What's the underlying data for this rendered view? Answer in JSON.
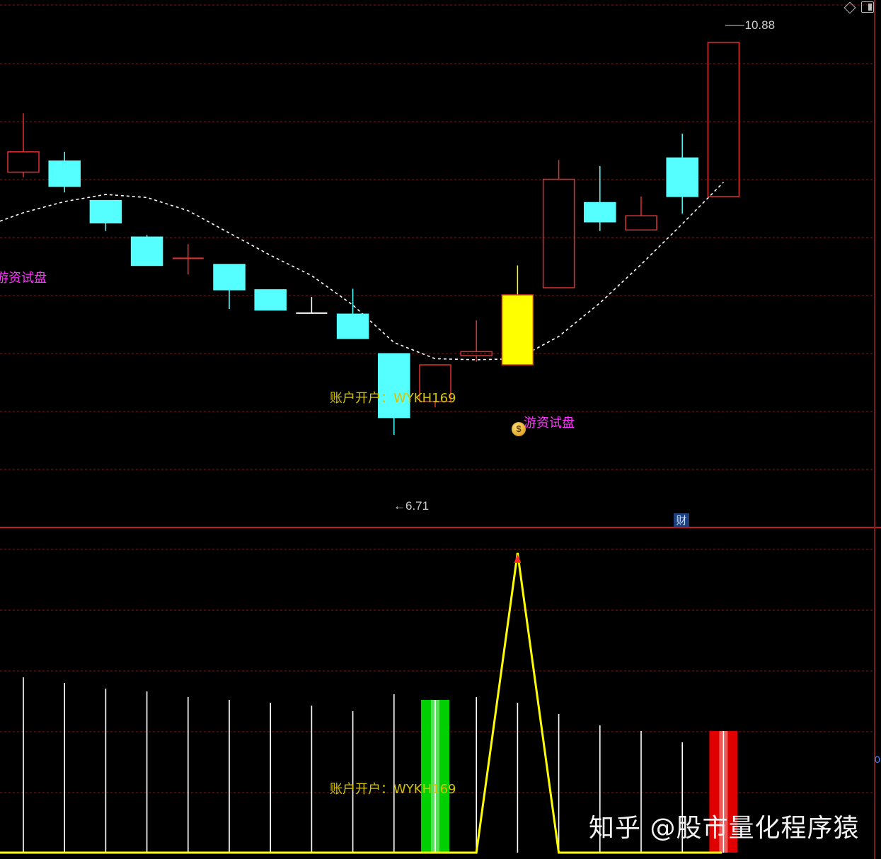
{
  "toolbar": {
    "icons": [
      "diamond-icon",
      "panel-toggle-icon"
    ]
  },
  "price_labels": {
    "high": "10.88",
    "low": "6.71"
  },
  "annotations": {
    "youzi_left": "游资试盘",
    "youzi_right": "游资试盘",
    "account_upper": "账户开户：WYKH169",
    "account_lower": "账户开户：WYKH169",
    "fin_badge": "财",
    "axis_edge": "0"
  },
  "watermark": "知乎 @股市量化程序猿",
  "colors": {
    "background": "#000000",
    "bear_body": "#55ffff",
    "bull_outline": "#e03030",
    "signal_candle": "#ffff00",
    "ma_line": "#ffffff",
    "grid": "#7a1a1a",
    "separator": "#c02020",
    "volume_line": "#ffffff",
    "signal_line": "#ffff00",
    "green_bar": "#00d000",
    "red_bar": "#e00000",
    "magenta_text": "#ff33ff"
  },
  "chart_data": [
    {
      "type": "candlestick",
      "price_range": [
        6.25,
        11.2
      ],
      "candles": [
        {
          "o": 9.6,
          "c": 9.8,
          "h": 10.18,
          "l": 9.55,
          "kind": "bull"
        },
        {
          "o": 9.71,
          "c": 9.46,
          "h": 9.8,
          "l": 9.4,
          "kind": "bear"
        },
        {
          "o": 9.32,
          "c": 9.1,
          "h": 9.32,
          "l": 9.02,
          "kind": "bear"
        },
        {
          "o": 8.96,
          "c": 8.68,
          "h": 8.98,
          "l": 8.68,
          "kind": "bear"
        },
        {
          "o": 8.75,
          "c": 8.75,
          "h": 8.89,
          "l": 8.59,
          "kind": "doji-red"
        },
        {
          "o": 8.69,
          "c": 8.44,
          "h": 8.69,
          "l": 8.25,
          "kind": "bear"
        },
        {
          "o": 8.44,
          "c": 8.24,
          "h": 8.44,
          "l": 8.24,
          "kind": "bear"
        },
        {
          "o": 8.21,
          "c": 8.21,
          "h": 8.37,
          "l": 8.21,
          "kind": "doji-white"
        },
        {
          "o": 8.2,
          "c": 7.96,
          "h": 8.45,
          "l": 7.96,
          "kind": "bear"
        },
        {
          "o": 7.81,
          "c": 7.18,
          "h": 7.81,
          "l": 7.01,
          "kind": "bear"
        },
        {
          "o": 7.34,
          "c": 7.7,
          "h": 7.7,
          "l": 7.28,
          "kind": "bull"
        },
        {
          "o": 7.79,
          "c": 7.83,
          "h": 8.14,
          "l": 7.73,
          "kind": "bull"
        },
        {
          "o": 7.7,
          "c": 8.39,
          "h": 8.68,
          "l": 7.7,
          "kind": "signal"
        },
        {
          "o": 8.46,
          "c": 9.53,
          "h": 9.72,
          "l": 8.46,
          "kind": "bull"
        },
        {
          "o": 9.11,
          "c": 9.3,
          "h": 9.66,
          "l": 9.02,
          "kind": "bear"
        },
        {
          "o": 9.03,
          "c": 9.17,
          "h": 9.36,
          "l": 9.03,
          "kind": "bull"
        },
        {
          "o": 9.74,
          "c": 9.36,
          "h": 9.98,
          "l": 9.19,
          "kind": "bear"
        },
        {
          "o": 9.36,
          "c": 10.88,
          "h": 10.88,
          "l": 9.36,
          "kind": "bull"
        }
      ],
      "ma": [
        9.2,
        9.31,
        9.38,
        9.35,
        9.22,
        9.0,
        8.78,
        8.58,
        8.29,
        7.92,
        7.76,
        7.75,
        7.76,
        7.98,
        8.31,
        8.69,
        9.09,
        9.5
      ],
      "high_label": 10.88,
      "low_label": 6.71
    },
    {
      "type": "volume-indicator",
      "volume": [
        0.62,
        0.6,
        0.58,
        0.57,
        0.55,
        0.54,
        0.53,
        0.52,
        0.5,
        0.56,
        0.54,
        0.55,
        0.53,
        0.49,
        0.45,
        0.43,
        0.39,
        0.43
      ],
      "signal": [
        0,
        0,
        0,
        0,
        0,
        0,
        0,
        0,
        0,
        0,
        0,
        0,
        1,
        0,
        0,
        0,
        0,
        0
      ],
      "green_bar_index": 10,
      "red_bar_index": 17
    }
  ]
}
